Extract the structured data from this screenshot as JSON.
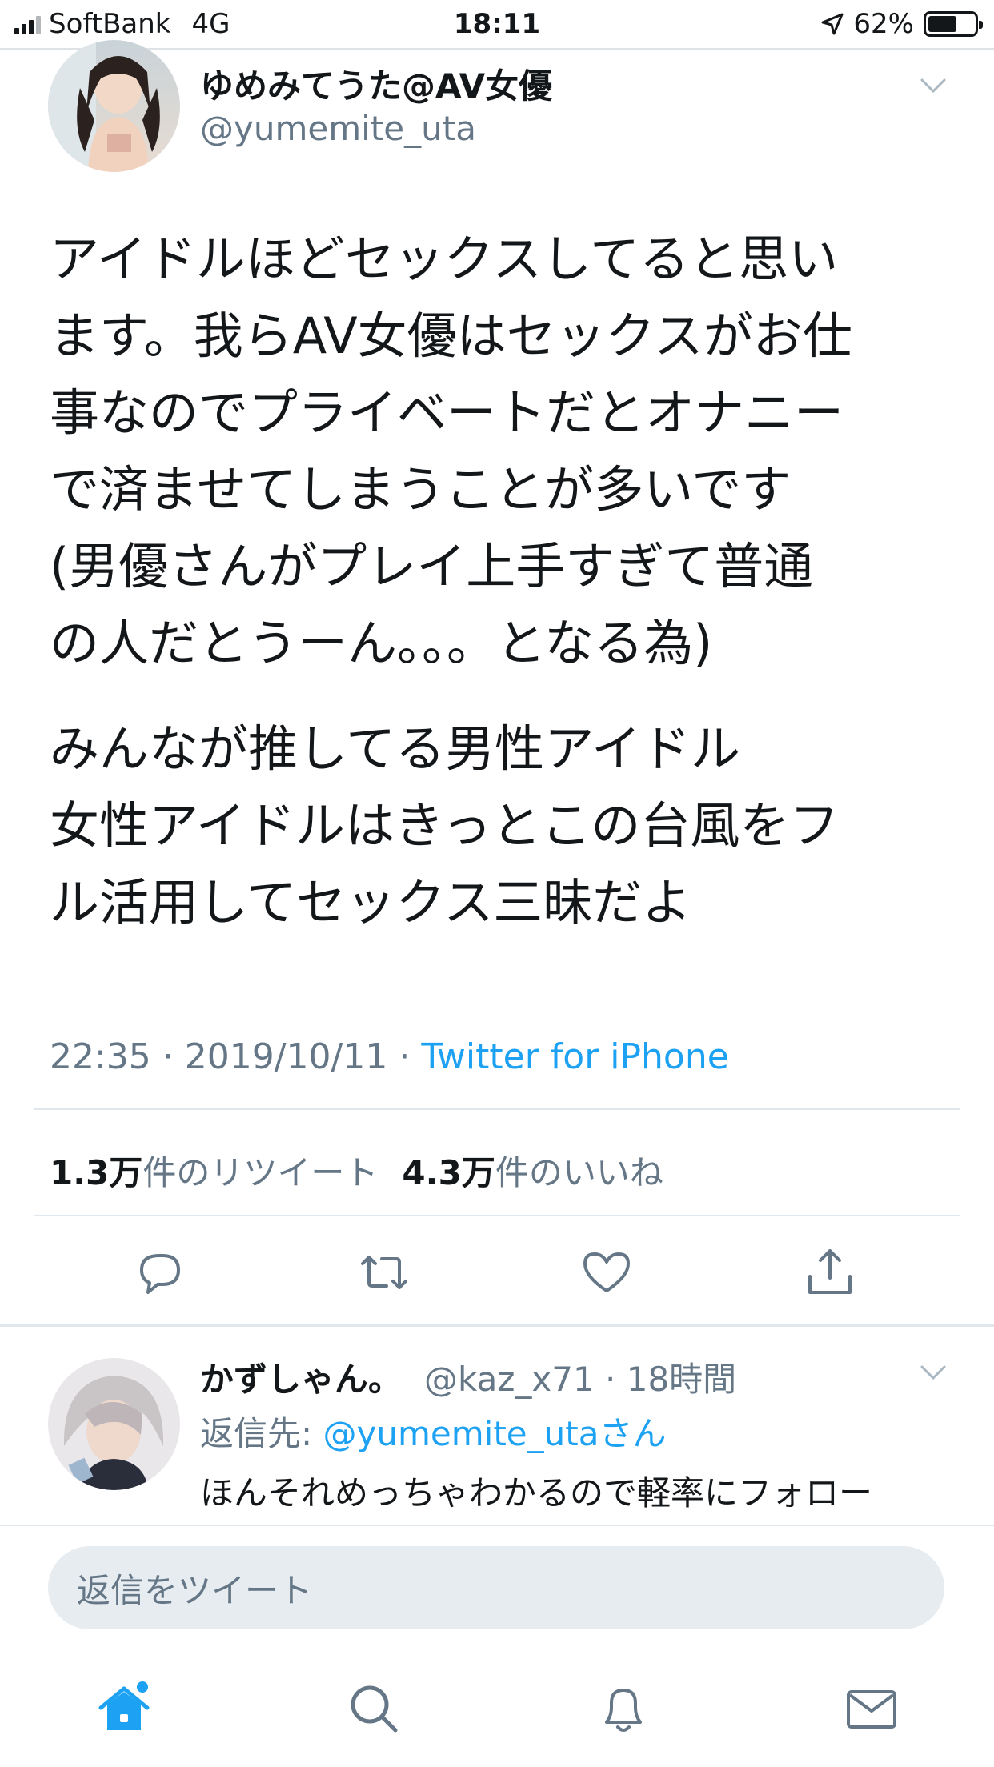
{
  "status_bar": {
    "carrier": "SoftBank",
    "network": "4G",
    "time": "18:11",
    "battery": "62%",
    "battery_level": 0.62
  },
  "tweet": {
    "author_name": "ゆめみてうた@AV女優",
    "author_handle": "@yumemite_uta",
    "paragraph_1": "アイドルほどセックスしてると思い\nます。我らAV女優はセックスがお仕\n事なのでプライベートだとオナニー\nで済ませてしまうことが多いです\n(男優さんがプレイ上手すぎて普通\nの人だとうーん。。。となる為)",
    "paragraph_2": "みんなが推してる男性アイドル\n女性アイドルはきっとこの台風をフ\nル活用してセックス三昧だよ",
    "time": "22:35 · 2019/10/11 · ",
    "source": "Twitter for iPhone",
    "retweets_count": "1.3万",
    "retweets_label": "件のリツイート",
    "likes_count": "4.3万",
    "likes_label": "件のいいね"
  },
  "reply": {
    "author_name": "かずしゃん。",
    "meta": "@kaz_x71 · 18時間",
    "reply_to_label": "返信先: ",
    "reply_to_handle": "@yumemite_utaさん",
    "text": "ほんそれめっちゃわかるので軽率にフォロー"
  },
  "composer": {
    "placeholder": "返信をツイート"
  },
  "colors": {
    "accent": "#1da1f2",
    "secondary_text": "#657786",
    "icon_gray": "#657786",
    "divider": "#e1e8ed"
  },
  "icons": {
    "actions": [
      "reply-icon",
      "retweet-icon",
      "like-icon",
      "share-icon"
    ],
    "tabs": [
      "home-icon",
      "search-icon",
      "notifications-icon",
      "messages-icon"
    ]
  }
}
